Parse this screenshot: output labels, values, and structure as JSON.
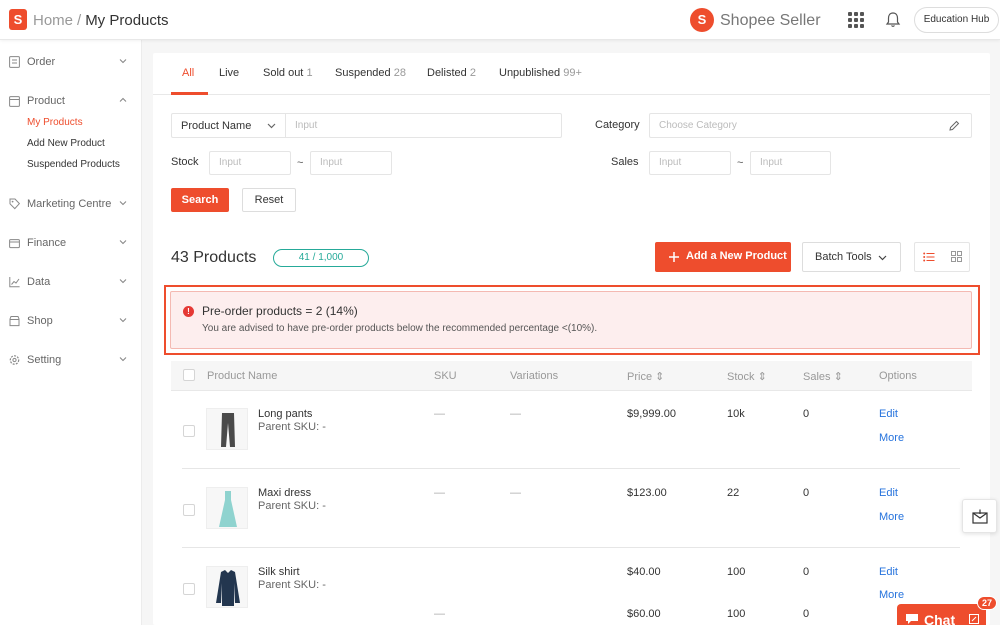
{
  "header": {
    "logo_glyph": "S",
    "breadcrumb_home": "Home",
    "breadcrumb_sep": "/",
    "breadcrumb_current": "My Products",
    "brand_glyph": "S",
    "brand_title": "Shopee Seller",
    "education_hub": "Education Hub"
  },
  "sidebar": {
    "groups": [
      {
        "label": "Order",
        "icon": "order-icon",
        "expanded": false
      },
      {
        "label": "Product",
        "icon": "product-icon",
        "expanded": true,
        "items": [
          {
            "label": "My Products",
            "active": true
          },
          {
            "label": "Add New Product",
            "active": false
          },
          {
            "label": "Suspended Products",
            "active": false
          }
        ]
      },
      {
        "label": "Marketing Centre",
        "icon": "tag-icon",
        "expanded": false
      },
      {
        "label": "Finance",
        "icon": "wallet-icon",
        "expanded": false
      },
      {
        "label": "Data",
        "icon": "chart-icon",
        "expanded": false
      },
      {
        "label": "Shop",
        "icon": "shop-icon",
        "expanded": false
      },
      {
        "label": "Setting",
        "icon": "gear-icon",
        "expanded": false
      }
    ]
  },
  "tabs": [
    {
      "label": "All",
      "count": "",
      "active": true
    },
    {
      "label": "Live",
      "count": ""
    },
    {
      "label": "Sold out",
      "count": "1"
    },
    {
      "label": "Suspended",
      "count": "28"
    },
    {
      "label": "Delisted",
      "count": "2"
    },
    {
      "label": "Unpublished",
      "count": "99+"
    }
  ],
  "filters": {
    "search_type": "Product Name",
    "search_placeholder": "Input",
    "category_label": "Category",
    "category_placeholder": "Choose Category",
    "stock_label": "Stock",
    "sales_label": "Sales",
    "range_placeholder": "Input",
    "range_sep": "~",
    "search_button": "Search",
    "reset_button": "Reset"
  },
  "summary": {
    "product_count": "43 Products",
    "quota": "41 / 1,000",
    "add_button": "Add a New Product",
    "batch_tools": "Batch Tools"
  },
  "alert": {
    "icon_glyph": "!",
    "title": "Pre-order products = 2 (14%)",
    "description": "You are advised to have pre-order products below the recommended percentage <(10%)."
  },
  "table": {
    "columns": [
      "Product Name",
      "SKU",
      "Variations",
      "Price",
      "Stock",
      "Sales",
      "Options"
    ],
    "sort_glyph": "⇕",
    "rows": [
      {
        "name": "Long pants",
        "parent_sku": "Parent SKU: -",
        "sku": "—",
        "variations": "—",
        "price": "$9,999.00",
        "stock": "10k",
        "sales": "0",
        "edit": "Edit",
        "more": "More",
        "thumb": "pants"
      },
      {
        "name": "Maxi dress",
        "parent_sku": "Parent SKU: -",
        "sku": "—",
        "variations": "—",
        "price": "$123.00",
        "stock": "22",
        "sales": "0",
        "edit": "Edit",
        "more": "More",
        "thumb": "dress"
      },
      {
        "name": "Silk shirt",
        "parent_sku": "Parent SKU: -",
        "sku": "",
        "variations": "",
        "price": "$40.00",
        "stock": "100",
        "sales": "0",
        "edit": "Edit",
        "more": "More",
        "thumb": "shirt",
        "variant_row": {
          "sku": "—",
          "price": "$60.00",
          "stock": "100",
          "sales": "0"
        }
      }
    ]
  },
  "floating": {
    "chat_label": "Chat",
    "chat_badge": "27"
  },
  "colors": {
    "brand": "#ee4d2d",
    "link": "#2673dd",
    "quota_teal": "#26aa99",
    "alert_bg": "#fdeeee"
  }
}
